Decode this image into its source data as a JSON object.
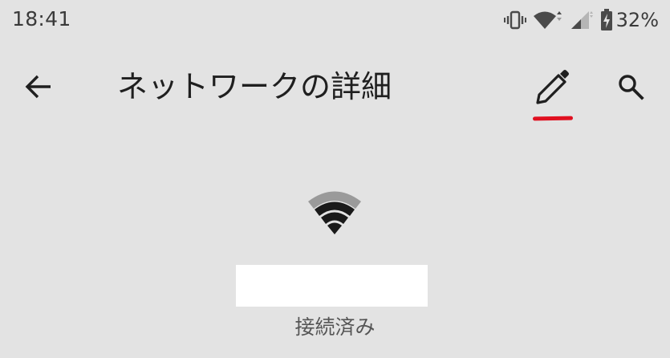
{
  "status_bar": {
    "time": "18:41",
    "battery_percent": "32%",
    "icons": [
      "vibrate-icon",
      "wifi-icon",
      "cell-signal-icon",
      "battery-charging-icon"
    ]
  },
  "app_bar": {
    "title": "ネットワークの詳細",
    "back_icon": "arrow-left-icon",
    "edit_icon": "pencil-icon",
    "search_icon": "search-icon"
  },
  "network": {
    "ssid": "",
    "status": "接続済み",
    "signal_icon": "wifi-signal-icon"
  },
  "colors": {
    "background": "#e3e3e3",
    "annotation_red": "#e01020"
  }
}
